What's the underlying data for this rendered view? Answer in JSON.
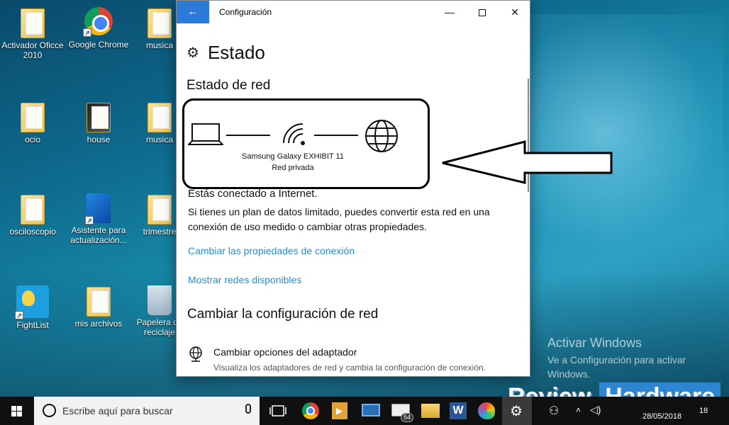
{
  "desktop": {
    "icons": [
      {
        "label": "Activador Oficce 2010"
      },
      {
        "label": "Google Chrome"
      },
      {
        "label": "musica"
      },
      {
        "label": "ocio"
      },
      {
        "label": "house"
      },
      {
        "label": "musica"
      },
      {
        "label": "osciloscopio"
      },
      {
        "label": "Asistente para actualización..."
      },
      {
        "label": "trimestre"
      },
      {
        "label": "FightList"
      },
      {
        "label": "mis archivos"
      },
      {
        "label": "Papelera de reciclaje"
      }
    ]
  },
  "window": {
    "title": "Configuración",
    "back_icon": "back-arrow-icon",
    "page_title": "Estado",
    "network_status_heading": "Estado de red",
    "network_name": "Samsung Galaxy EXHIBIT 11",
    "network_type": "Red privada",
    "connected_text": "Estás conectado a Internet.",
    "description": "Si tienes un plan de datos limitado, puedes convertir esta red en una conexión de uso medido o cambiar otras propiedades.",
    "link_change_properties": "Cambiar las propiedades de conexión",
    "link_show_networks": "Mostrar redes disponibles",
    "change_config_heading": "Cambiar la configuración de red",
    "adapter_title": "Cambiar opciones del adaptador",
    "adapter_desc": "Visualiza los adaptadores de red y cambia la configuración de conexión."
  },
  "watermark": {
    "title": "Activar Windows",
    "subtitle": "Ve a Configuración para activar Windows."
  },
  "logo": {
    "review": "Review",
    "hardware": "Hardware"
  },
  "taskbar": {
    "search_placeholder": "Escribe aquí para buscar",
    "mail_badge": "54",
    "date": "28/05/2018",
    "notif_count": "18"
  },
  "colors": {
    "accent": "#2b7bd8",
    "link": "#2a8ccf",
    "taskbar": "#101010"
  }
}
